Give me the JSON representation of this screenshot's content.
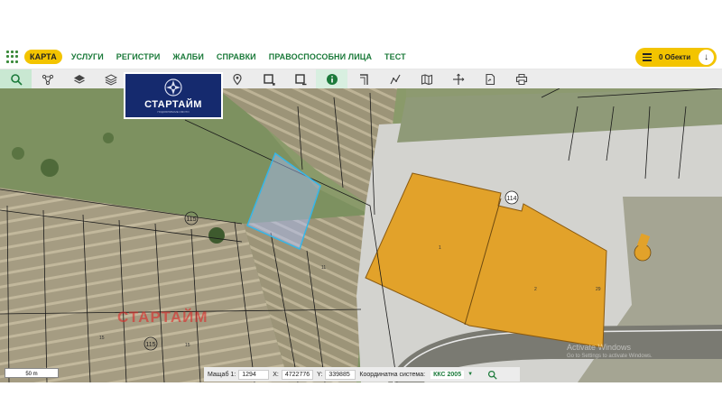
{
  "nav": {
    "items": [
      "КАРТА",
      "УСЛУГИ",
      "РЕГИСТРИ",
      "ЖАЛБИ",
      "СПРАВКИ",
      "ПРАВОСПОСОБНИ ЛИЦА",
      "ТЕСТ"
    ],
    "active_index": 0
  },
  "objects": {
    "label": "0 Обекти",
    "arrow": "↓"
  },
  "toolbar": {
    "tools": [
      "search-icon",
      "route-icon",
      "layers-icon",
      "stack-icon",
      "hidden-1",
      "hidden-2",
      "hidden-3",
      "location-pin-icon",
      "select-rect-icon",
      "select-rect-minus-icon",
      "info-icon",
      "measure-angle-icon",
      "measure-path-icon",
      "map-book-icon",
      "crosshair-icon",
      "document-icon",
      "print-icon"
    ]
  },
  "logo": {
    "text": "СТАРТАЙМ",
    "sub": "ПОДОБРЯВАМЕ ИМОТИ"
  },
  "map": {
    "watermark": "СТАРТАЙМ",
    "windows_line1": "Activate Windows",
    "windows_line2": "Go to Settings to activate Windows.",
    "labels": {
      "num_115_a": "115",
      "num_115_b": "115",
      "num_114": "114",
      "parcel_1": "1",
      "parcel_2": "2",
      "parcel_29": "29",
      "parcel_15": "15",
      "parcel_11": "11",
      "parcel_15b": "15"
    }
  },
  "scale": {
    "label": "50 m"
  },
  "status": {
    "scale_label": "Мащаб 1:",
    "scale_value": "1294",
    "x_label": "X:",
    "x_value": "4722776",
    "y_label": "Y:",
    "y_value": "339885",
    "crs_label": "Координатна система:",
    "crs_value": "ККС 2005",
    "crs_arrow": "▼"
  },
  "colors": {
    "accent_green": "#1b7a3a",
    "accent_yellow": "#f3c400",
    "building_orange": "#e2a22a",
    "selected_parcel": "#35b6e8"
  }
}
